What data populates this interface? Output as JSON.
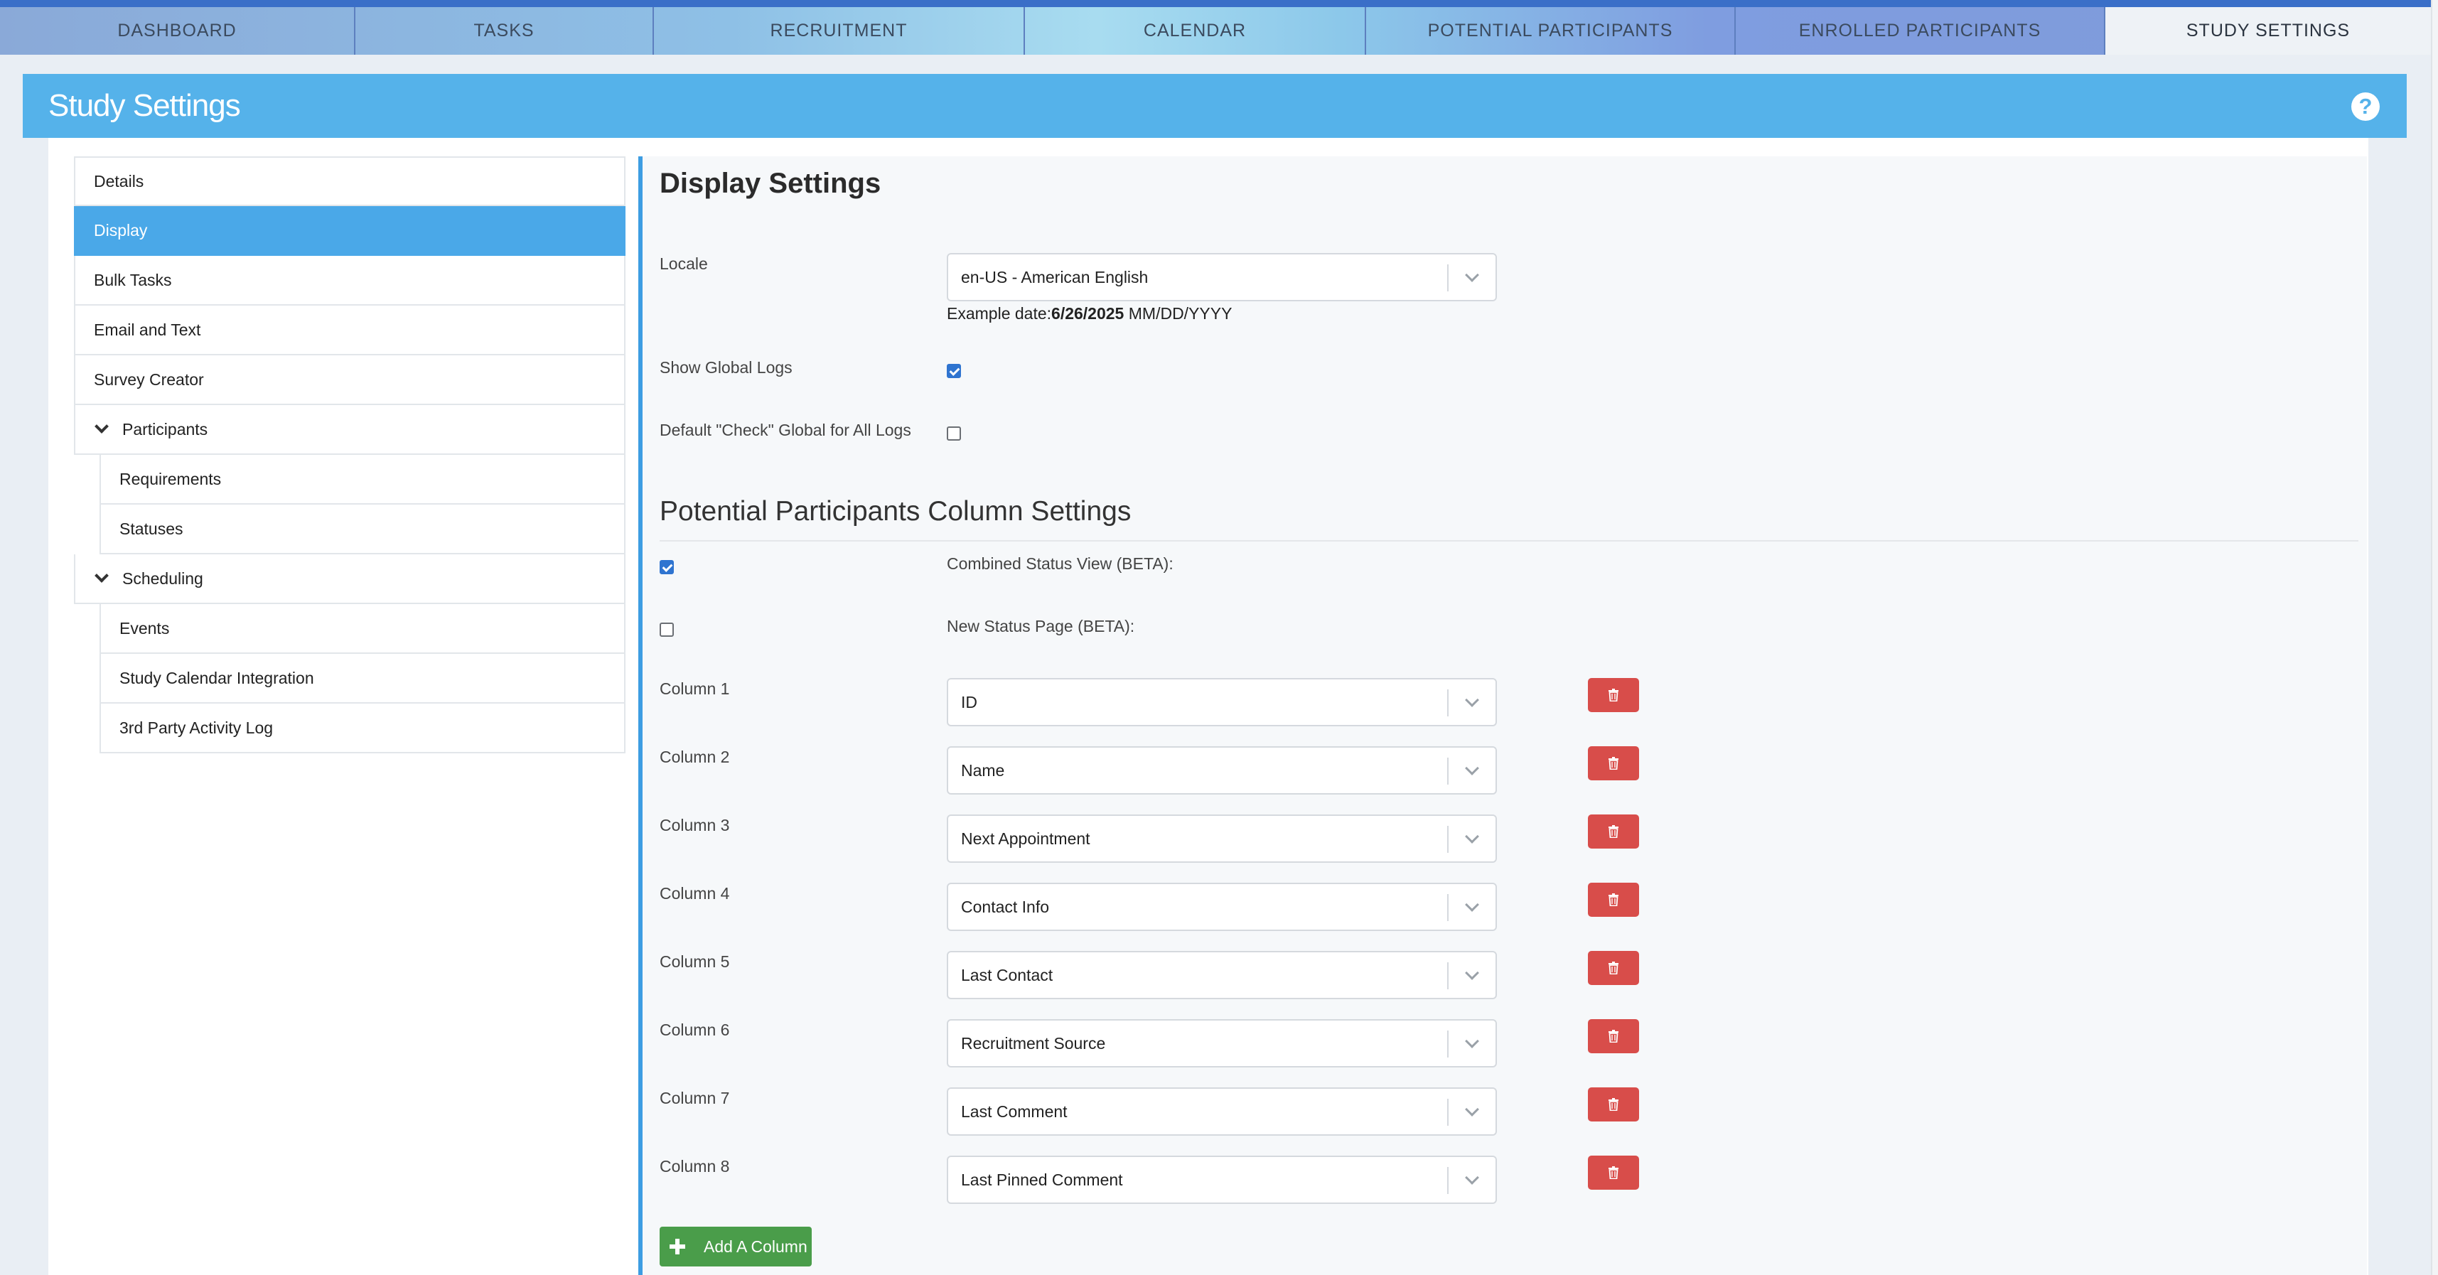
{
  "nav": {
    "tabs": [
      {
        "label": "DASHBOARD"
      },
      {
        "label": "TASKS"
      },
      {
        "label": "RECRUITMENT"
      },
      {
        "label": "CALENDAR"
      },
      {
        "label": "POTENTIAL PARTICIPANTS"
      },
      {
        "label": "ENROLLED PARTICIPANTS"
      },
      {
        "label": "STUDY SETTINGS",
        "active": true
      }
    ]
  },
  "header": {
    "title": "Study Settings",
    "help_icon": "question-circle-icon"
  },
  "sidebar": {
    "items": [
      {
        "label": "Details"
      },
      {
        "label": "Display",
        "active": true
      },
      {
        "label": "Bulk Tasks"
      },
      {
        "label": "Email and Text"
      },
      {
        "label": "Survey Creator"
      },
      {
        "label": "Participants",
        "expanded": true
      },
      {
        "label": "Requirements"
      },
      {
        "label": "Statuses"
      },
      {
        "label": "Scheduling",
        "expanded": true
      },
      {
        "label": "Events"
      },
      {
        "label": "Study Calendar Integration"
      },
      {
        "label": "3rd Party Activity Log"
      }
    ]
  },
  "display": {
    "title": "Display Settings",
    "locale_label": "Locale",
    "locale_value": "en-US - American English",
    "example_prefix": "Example date:",
    "example_date": "6/26/2025",
    "example_format": "MM/DD/YYYY",
    "show_global_logs_label": "Show Global Logs",
    "show_global_logs": true,
    "default_check_label": "Default \"Check\" Global for All Logs",
    "default_check": false
  },
  "columns_section": {
    "title": "Potential Participants Column Settings",
    "combined_status_label": "Combined Status View (BETA):",
    "combined_status": true,
    "new_status_label": "New Status Page (BETA):",
    "new_status": false,
    "columns": [
      {
        "label": "Column 1",
        "value": "ID"
      },
      {
        "label": "Column 2",
        "value": "Name"
      },
      {
        "label": "Column 3",
        "value": "Next Appointment"
      },
      {
        "label": "Column 4",
        "value": "Contact Info"
      },
      {
        "label": "Column 5",
        "value": "Last Contact"
      },
      {
        "label": "Column 6",
        "value": "Recruitment Source"
      },
      {
        "label": "Column 7",
        "value": "Last Comment"
      },
      {
        "label": "Column 8",
        "value": "Last Pinned Comment"
      }
    ],
    "add_label": "Add A Column",
    "delete_icon": "trash-icon",
    "colors": {
      "delete": "#d84d4a",
      "add": "#4a9d4a",
      "accent": "#55b2ea"
    }
  }
}
